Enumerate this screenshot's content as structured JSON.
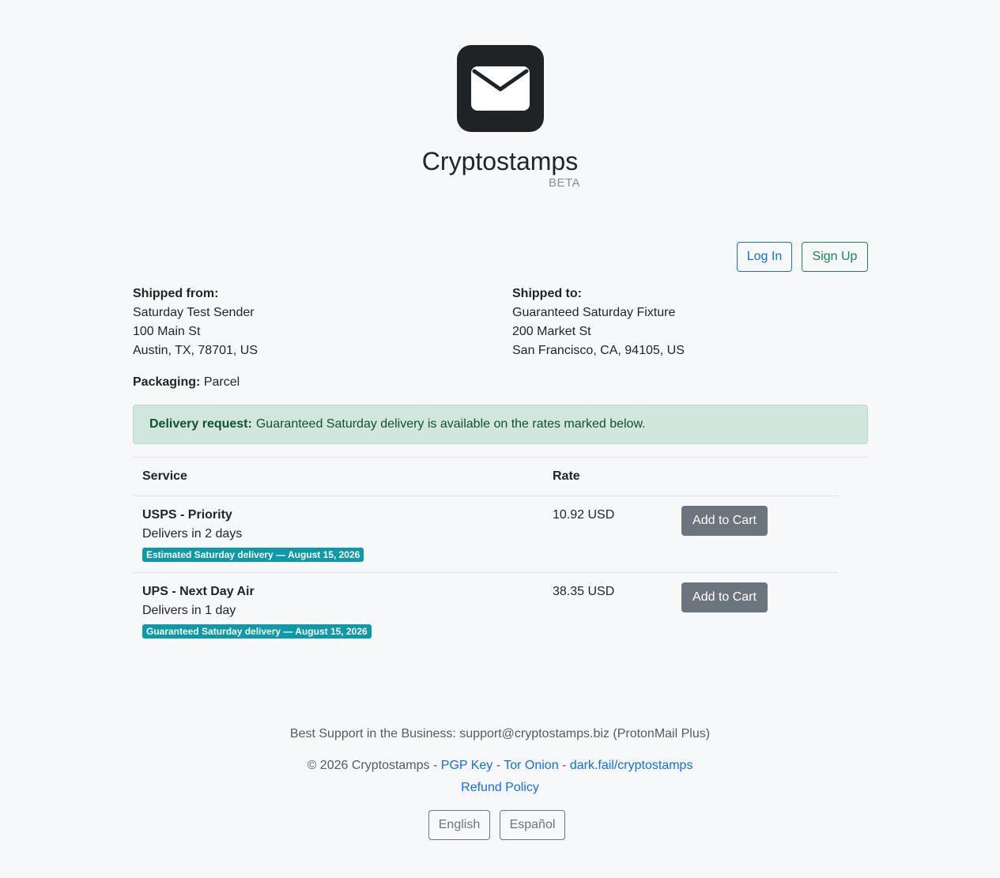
{
  "header": {
    "brand": "Cryptostamps",
    "beta": "BETA",
    "logo_icon": "envelope-icon"
  },
  "auth": {
    "login_label": "Log In",
    "signup_label": "Sign Up"
  },
  "shipment": {
    "from": {
      "label": "Shipped from:",
      "name": "Saturday Test Sender",
      "street": "100 Main St",
      "city_line": "Austin, TX, 78701, US"
    },
    "to": {
      "label": "Shipped to:",
      "name": "Guaranteed Saturday Fixture",
      "street": "200 Market St",
      "city_line": "San Francisco, CA, 94105, US"
    },
    "packaging_label": "Packaging:",
    "packaging_value": "Parcel"
  },
  "alert": {
    "label": "Delivery request:",
    "text": "Guaranteed Saturday delivery is available on the rates marked below."
  },
  "rates_table": {
    "headers": {
      "service": "Service",
      "rate": "Rate"
    },
    "rows": [
      {
        "service": "USPS - Priority",
        "eta": "Delivers in 2 days",
        "badge": "Estimated Saturday delivery — August 15, 2026",
        "rate": "10.92 USD",
        "action": "Add to Cart"
      },
      {
        "service": "UPS - Next Day Air",
        "eta": "Delivers in 1 day",
        "badge": "Guaranteed Saturday delivery — August 15, 2026",
        "rate": "38.35 USD",
        "action": "Add to Cart"
      }
    ]
  },
  "footer": {
    "support": "Best Support in the Business: support@cryptostamps.biz (ProtonMail Plus)",
    "copyright": "© 2026 Cryptostamps",
    "separator": "-",
    "links": {
      "pgp": "PGP Key",
      "tor": "Tor Onion",
      "darkfail": "dark.fail/cryptostamps",
      "refund": "Refund Policy"
    },
    "languages": {
      "english": "English",
      "spanish": "Español"
    }
  },
  "colors": {
    "primary": "#0d6efd",
    "success": "#198754",
    "secondary": "#6c757d",
    "badge": "#0d9aa6",
    "alert_bg": "#d1e7dd"
  }
}
